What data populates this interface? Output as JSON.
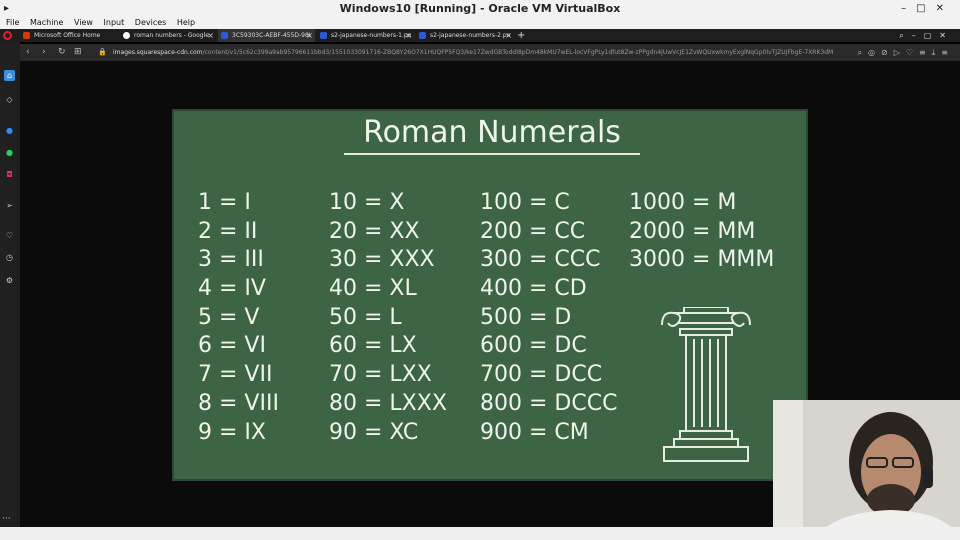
{
  "window": {
    "title": "Windows10 [Running] - Oracle VM VirtualBox",
    "menu": [
      "File",
      "Machine",
      "View",
      "Input",
      "Devices",
      "Help"
    ]
  },
  "browser": {
    "tabs": [
      {
        "label": "Microsoft Office Home",
        "color": "#d83b01"
      },
      {
        "label": "roman numbers - Google",
        "color": "#ffffff"
      },
      {
        "label": "3C59303C-AEBF-455D-98I",
        "color": "#2a5bd7"
      },
      {
        "label": "s2-japanese-numbers-1.pn",
        "color": "#2a5bd7"
      },
      {
        "label": "s2-japanese-numbers-2.pn",
        "color": "#2a5bd7"
      }
    ],
    "url_domain": "images.squarespace-cdn.com",
    "url_path": "/content/v1/5c62c399a9ab95796611bbd3/1551033091716-ZBQ8Y26O7X1HUQFP5FQ3/ke17ZwdGBToddI8pDm48kMU7wEL-locVFgPLy1dfut8Zw-zPPgdn4jUwVcJE1ZvWQUxwkmyExglNqGp0IvTJZUJFbgE-7XRK3dM"
  },
  "board": {
    "title": "Roman Numerals",
    "columns": [
      [
        "1 = I",
        "2 = II",
        "3 = III",
        "4 = IV",
        "5 = V",
        "6 = VI",
        "7 = VII",
        "8 = VIII",
        "9 = IX"
      ],
      [
        "10 = X",
        "20 = XX",
        "30 = XXX",
        "40 = XL",
        "50 = L",
        "60 = LX",
        "70 = LXX",
        "80 = LXXX",
        "90 = XC"
      ],
      [
        "100 = C",
        "200 = CC",
        "300 = CCC",
        "400 = CD",
        "500 = D",
        "600 = DC",
        "700 = DCC",
        "800 = DCCC",
        "900 = CM"
      ],
      [
        "1000 = M",
        "2000 = MM",
        "3000 = MMM"
      ]
    ]
  },
  "icons": {
    "sidebar": [
      "home-icon",
      "gem-icon",
      "messenger-icon",
      "whatsapp-icon",
      "instagram-icon",
      "send-icon",
      "heart-icon",
      "history-icon",
      "settings-icon"
    ]
  }
}
